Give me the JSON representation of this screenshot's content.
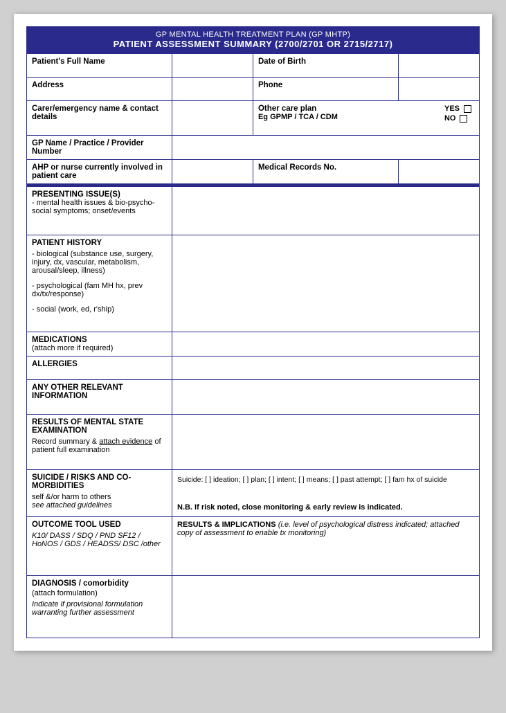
{
  "header": {
    "line1": "GP MENTAL HEALTH TREATMENT PLAN (GP MHTP)",
    "line2": "PATIENT ASSESSMENT SUMMARY (2700/2701 OR 2715/2717)"
  },
  "fields": {
    "patient_full_name_label": "Patient's Full Name",
    "date_of_birth_label": "Date of Birth",
    "address_label": "Address",
    "phone_label": "Phone",
    "carer_label": "Carer/emergency name & contact details",
    "other_care_plan_label": "Other care plan",
    "eg_label": "Eg GPMP / TCA / CDM",
    "yes_label": "YES",
    "no_label": "NO",
    "gp_name_label": "GP Name / Practice / Provider Number",
    "ahp_label": "AHP or nurse currently involved in patient care",
    "medical_records_label": "Medical Records No.",
    "presenting_label": "PRESENTING ISSUE(S)",
    "presenting_sub": "- mental health issues & bio-psycho-social symptoms; onset/events",
    "patient_history_label": "PATIENT HISTORY",
    "patient_history_sub1": "- biological (substance use, surgery, injury, dx, vascular, metabolism, arousal/sleep, illness)",
    "patient_history_sub2": "- psychological (fam MH hx, prev dx/tx/response)",
    "patient_history_sub3": "- social (work, ed, r'ship)",
    "medications_label": "MEDICATIONS",
    "medications_sub": "(attach more if required)",
    "allergies_label": "ALLERGIES",
    "any_other_label": "ANY OTHER RELEVANT INFORMATION",
    "results_mse_label": "RESULTS OF MENTAL STATE EXAMINATION",
    "results_mse_sub1": "Record summary &",
    "results_mse_sub2": "attach evidence",
    "results_mse_sub3": "of patient full examination",
    "suicide_label": "SUICIDE / RISKS AND CO-MORBIDITIES",
    "suicide_sub1": "self &/or harm to others",
    "suicide_sub2": "see attached guidelines",
    "suicide_checkboxes": "Suicide: [  ] ideation;  [  ] plan;  [  ] intent;  [  ] means;  [  ] past attempt;  [  ] fam hx of suicide",
    "nb_text": "N.B. If risk noted, close monitoring & early review is indicated.",
    "outcome_label": "OUTCOME TOOL USED",
    "outcome_sub": "K10/ DASS / SDQ / PND SF12 / HoNOS / GDS / HEADSS/ DSC  /other",
    "results_implications_label": "RESULTS & IMPLICATIONS",
    "results_implications_sub": "(i.e. level of psychological distress indicated; attached copy of assessment to enable tx monitoring)",
    "diagnosis_label": "DIAGNOSIS / comorbidity",
    "diagnosis_sub1": "(attach formulation)",
    "diagnosis_sub2": "Indicate if provisional formulation warranting further assessment"
  }
}
